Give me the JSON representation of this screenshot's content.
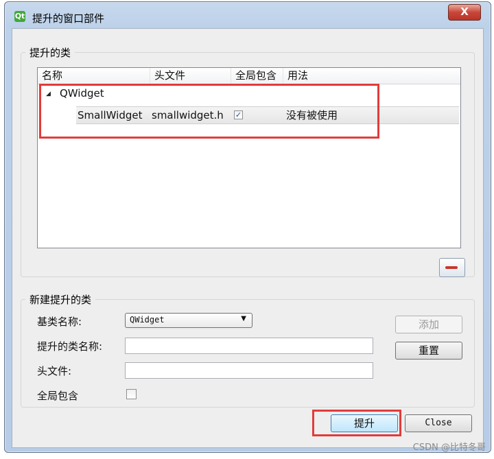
{
  "window": {
    "title": "提升的窗口部件",
    "app_icon_glyph": "Qt",
    "close_glyph": "X"
  },
  "promoted_group": {
    "legend": "提升的类",
    "columns": [
      "名称",
      "头文件",
      "全局包含",
      "用法"
    ],
    "parent": {
      "name": "QWidget",
      "expand_glyph": "◢"
    },
    "rows": [
      {
        "name": "SmallWidget",
        "header": "smallwidget.h",
        "global_include": true,
        "check_glyph": "✓",
        "usage": "没有被使用"
      }
    ]
  },
  "new_group": {
    "legend": "新建提升的类",
    "base_class_label": "基类名称:",
    "base_class_value": "QWidget",
    "combo_arrow": "▼",
    "promoted_name_label": "提升的类名称:",
    "promoted_name_value": "",
    "header_label": "头文件:",
    "header_value": "",
    "global_include_label": "全局包含",
    "global_include_checked": false,
    "add_button": "添加",
    "reset_button": "重置"
  },
  "footer": {
    "promote_button": "提升",
    "close_button": "Close"
  },
  "watermark": "CSDN @比特冬哥",
  "colors": {
    "highlight": "#e23b3b",
    "title_bar": "#bcd1ea",
    "close_button": "#c8473a"
  }
}
